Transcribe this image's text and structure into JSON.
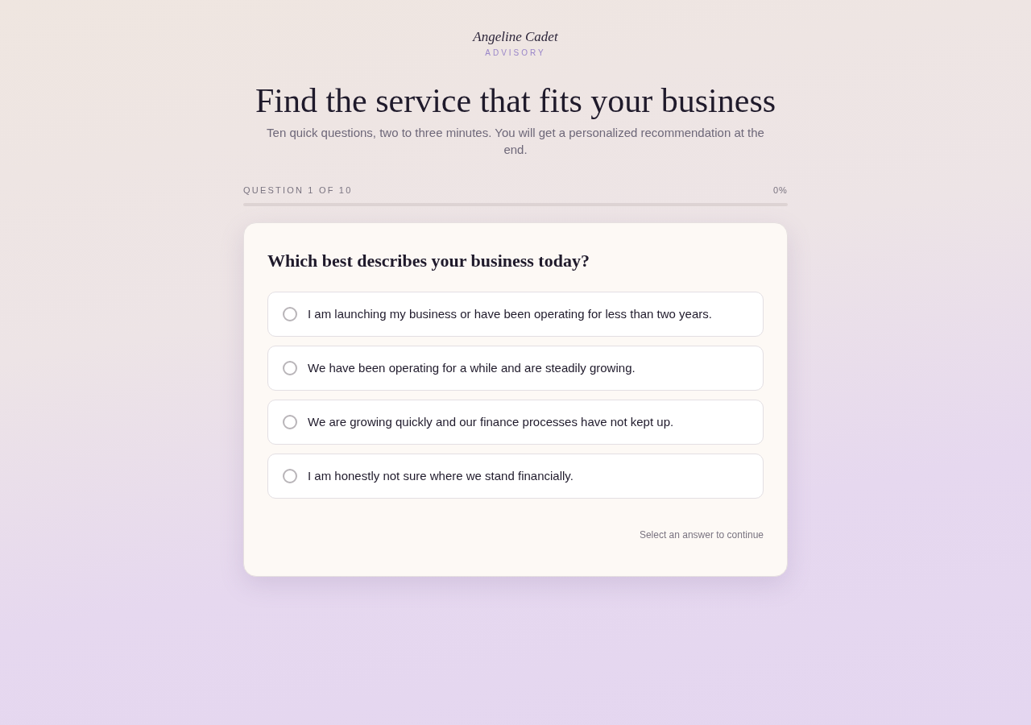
{
  "brand": {
    "name": "Angeline Cadet",
    "tagline": "ADVISORY"
  },
  "heading": "Find the service that fits your business",
  "subheading": "Ten quick questions, two to three minutes. You will get a personalized recommendation at the end.",
  "progress": {
    "label": "QUESTION 1 OF 10",
    "percent": "0%",
    "level": 0
  },
  "question": {
    "title": "Which best describes your business today?",
    "options": [
      {
        "label": "I am launching my business or have been operating for less than two years.",
        "selected": false
      },
      {
        "label": "We have been operating for a while and are steadily growing.",
        "selected": false
      },
      {
        "label": "We are growing quickly and our finance processes have not kept up.",
        "selected": false
      },
      {
        "label": "I am honestly not sure where we stand financially.",
        "selected": false
      }
    ],
    "hint": "Select an answer to continue"
  }
}
